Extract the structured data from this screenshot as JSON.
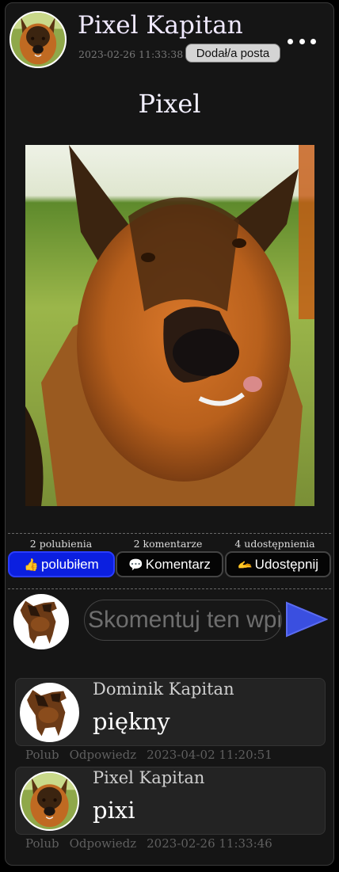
{
  "post": {
    "author": "Pixel Kapitan",
    "timestamp": "2023-02-26 11:33:38",
    "badge": "Dodał/a posta",
    "title": "Pixel"
  },
  "stats": {
    "likes": "2 polubienia",
    "comments": "2 komentarze",
    "shares": "4 udostępnienia"
  },
  "actions": {
    "like": "polubiłem",
    "comment": "Komentarz",
    "share": "Udostępnij"
  },
  "comment_form": {
    "placeholder": "Skomentuj ten wpis"
  },
  "comments": [
    {
      "author": "Dominik Kapitan",
      "text": "piękny",
      "like": "Polub",
      "reply": "Odpowiedz",
      "time": "2023-04-02 11:20:51"
    },
    {
      "author": "Pixel Kapitan",
      "text": "pixi",
      "like": "Polub",
      "reply": "Odpowiedz",
      "time": "2023-02-26 11:33:46"
    }
  ],
  "colors": {
    "background": "#151515",
    "liked_button": "#0b1fe0",
    "send_arrow": "#3a4fe0",
    "badge": "#d4d4d4"
  }
}
